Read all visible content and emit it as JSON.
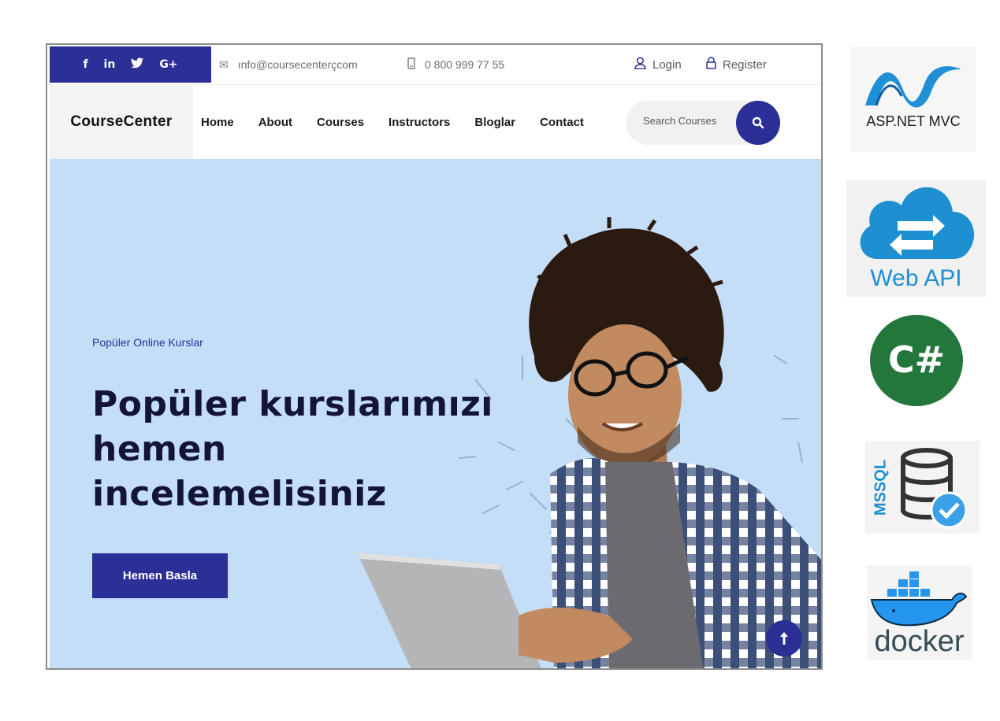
{
  "topbar": {
    "social": [
      "f",
      "in",
      "🐦",
      "G+"
    ],
    "email": "ınfo@coursecenterçcom",
    "phone": "0 800 999 77 55",
    "login": "Login",
    "register": "Register"
  },
  "nav": {
    "logo": "CourseCenter",
    "items": [
      "Home",
      "About",
      "Courses",
      "Instructors",
      "Bloglar",
      "Contact"
    ],
    "search_placeholder": "Search Courses"
  },
  "hero": {
    "eyebrow": "Popüler Online Kurslar",
    "headline": [
      "Popüler kurslarımızı",
      "hemen",
      "incelemelisiniz"
    ],
    "cta": "Hemen Basla"
  },
  "tech": {
    "aspnet": "ASP.NET MVC",
    "webapi": "Web API",
    "csharp": "C#",
    "mssql": "MSSQL",
    "docker": "docker"
  },
  "colors": {
    "brand": "#2b2f96",
    "hero_bg": "#c4def8",
    "headline": "#141536"
  }
}
